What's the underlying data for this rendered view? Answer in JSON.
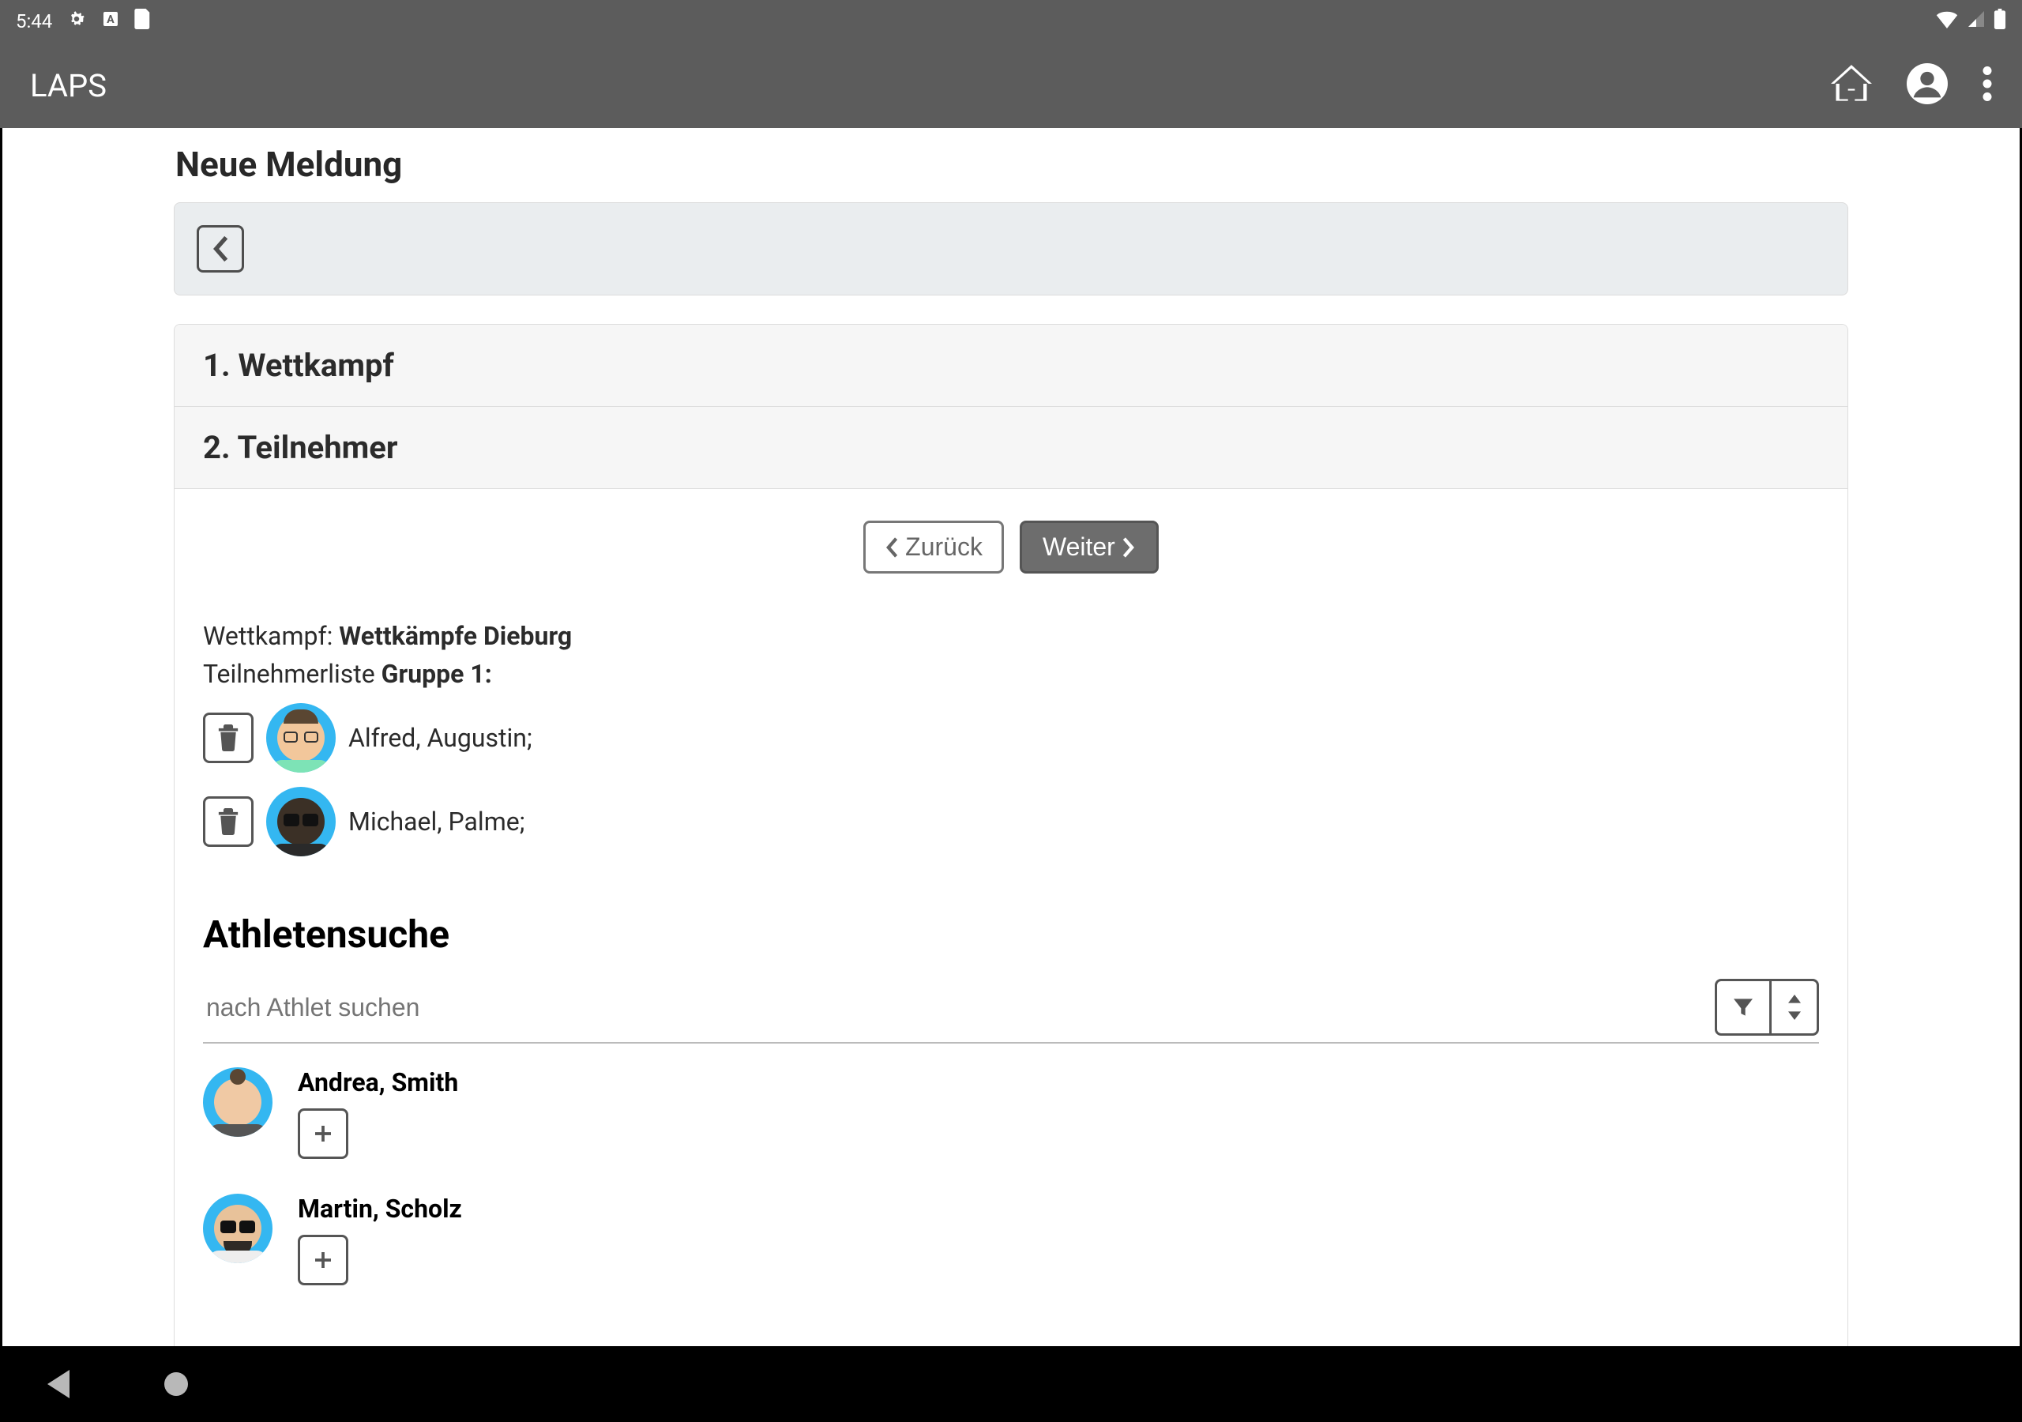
{
  "status": {
    "time": "5:44"
  },
  "app": {
    "title": "LAPS"
  },
  "page": {
    "heading": "Neue Meldung",
    "step1_label": "1. Wettkampf",
    "step2_label": "2. Teilnehmer",
    "back_btn": "Zurück",
    "next_btn": "Weiter",
    "competition_label": "Wettkampf: ",
    "competition_name": "Wettkämpfe Dieburg",
    "list_label": "Teilnehmerliste ",
    "group_label": "Gruppe 1:"
  },
  "participants": [
    {
      "name": "Alfred, Augustin;"
    },
    {
      "name": "Michael, Palme;"
    }
  ],
  "search": {
    "title": "Athletensuche",
    "placeholder": "nach Athlet suchen"
  },
  "results": [
    {
      "name": "Andrea, Smith"
    },
    {
      "name": "Martin, Scholz"
    }
  ]
}
